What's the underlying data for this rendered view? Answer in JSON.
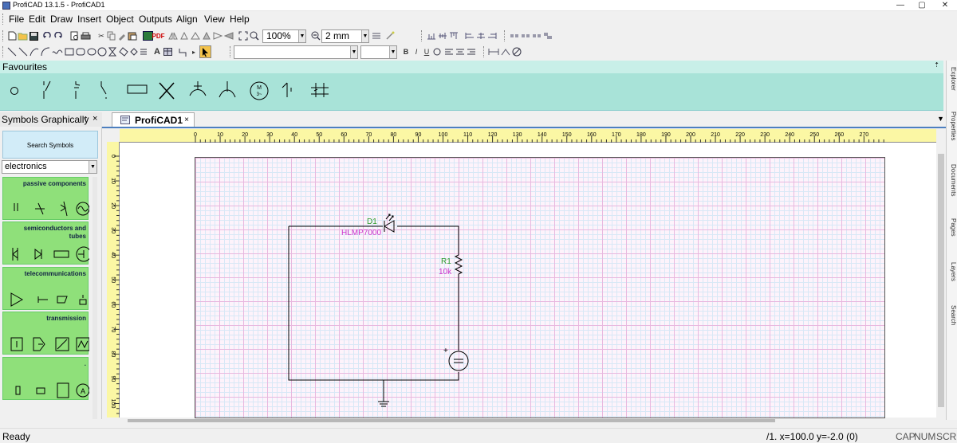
{
  "window": {
    "title": "ProfiCAD 13.1.5 - ProfiCAD1",
    "minimize": "—",
    "maximize": "▢",
    "close": "✕"
  },
  "menu": [
    "File",
    "Edit",
    "Draw",
    "Insert",
    "Object",
    "Outputs",
    "Align",
    "View",
    "Help"
  ],
  "toolbar": {
    "zoom_value": "100%",
    "grid_value": "2 mm",
    "pdf_label": "PDF",
    "format_bold": "B",
    "format_italic": "I",
    "format_underline": "U",
    "text_tool": "A"
  },
  "favourites": {
    "title": "Favourites",
    "pin": "⇡",
    "close": "×",
    "motor_symbol_text": "M\n3~"
  },
  "symbols_panel": {
    "title": "Symbols Graphically",
    "pin": "⇡",
    "close": "×",
    "search_button": "Search Symbols",
    "category_select": "electronics",
    "categories": [
      {
        "label": "passive components"
      },
      {
        "label": "semiconductors and tubes"
      },
      {
        "label": "telecommunications"
      },
      {
        "label": "transmission"
      },
      {
        "label": "."
      }
    ]
  },
  "document_tab": {
    "label": "ProfiCAD1",
    "close": "×"
  },
  "ruler": {
    "horizontal": [
      "0",
      "10",
      "20",
      "30",
      "40",
      "50",
      "60",
      "70",
      "80",
      "90",
      "100",
      "110",
      "120",
      "130",
      "140",
      "150",
      "160",
      "170",
      "180",
      "190",
      "200",
      "210",
      "220",
      "230",
      "240",
      "250",
      "260",
      "270"
    ],
    "vertical": [
      "0",
      "10",
      "20",
      "30",
      "40",
      "50",
      "60",
      "70",
      "80",
      "90",
      "100"
    ]
  },
  "schematic": {
    "d1_ref": "D1",
    "d1_value": "HLMP7000",
    "r1_ref": "R1",
    "r1_value": "10k",
    "source_plus": "+",
    "colors": {
      "ref": "#2a9a2a",
      "value": "#cc33cc",
      "wire": "#000000"
    }
  },
  "side_tabs": [
    "Explorer",
    "Properties",
    "Documents",
    "Pages",
    "Layers",
    "Search"
  ],
  "status": {
    "ready": "Ready",
    "coords": "/1.  x=100.0  y=-2.0 (0)",
    "cap": "CAP",
    "num": "NUM",
    "scrl": "SCRL"
  }
}
